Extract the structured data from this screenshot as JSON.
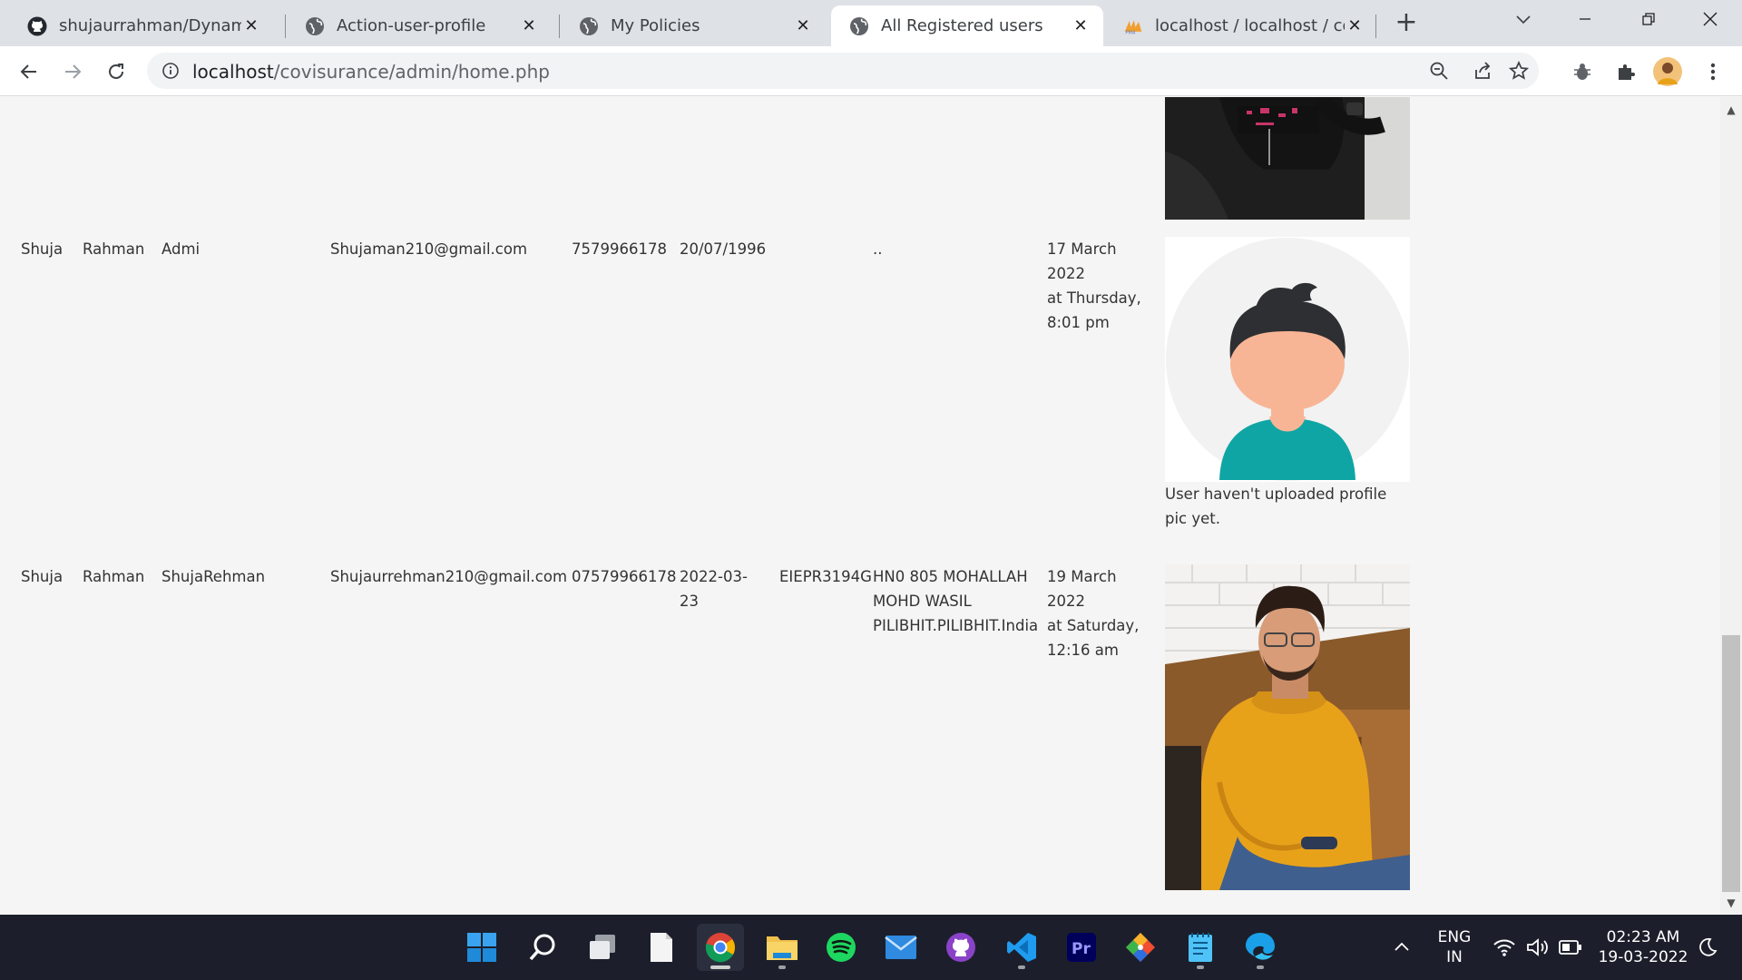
{
  "browser": {
    "tabs": [
      {
        "title": "shujaurrahman/Dynamic-…",
        "icon": "github-icon"
      },
      {
        "title": "Action-user-profile",
        "icon": "globe-icon"
      },
      {
        "title": "My Policies",
        "icon": "globe-icon"
      },
      {
        "title": "All Registered users",
        "icon": "globe-icon",
        "active": true
      },
      {
        "title": "localhost / localhost / cov",
        "icon": "phpmyadmin-icon"
      }
    ],
    "url_host": "localhost",
    "url_path": "/covisurance/admin/home.php"
  },
  "users": [
    {
      "first_name": "Shuja",
      "last_name": "Rahman",
      "username": "Admi",
      "email": "Shujaman210@gmail.com",
      "phone": "7579966178",
      "dob": "20/07/1996",
      "pan": "",
      "address": "..",
      "registered": [
        "17 March 2022",
        "at Thursday,",
        "8:01 pm"
      ],
      "photo": "default-avatar",
      "photo_note": "User haven't uploaded profile pic yet."
    },
    {
      "first_name": "Shuja",
      "last_name": "Rahman",
      "username": "ShujaRehman",
      "email": "Shujaurrehman210@gmail.com",
      "phone": "07579966178",
      "dob_lines": [
        "2022-03-",
        "23"
      ],
      "pan": "EIEPR3194G",
      "address_lines": [
        "HN0 805 MOHALLAH",
        "MOHD WASIL",
        "PILIBHIT.PILIBHIT.India"
      ],
      "registered": [
        "19 March 2022",
        "at Saturday,",
        "12:16 am"
      ],
      "photo": "uploaded-photo"
    }
  ],
  "taskbar": {
    "apps": [
      "windows-start-icon",
      "search-icon",
      "task-view-icon",
      "notepad-file-icon",
      "chrome-icon",
      "file-explorer-icon",
      "spotify-icon",
      "mail-icon",
      "github-desktop-icon",
      "vscode-icon",
      "premiere-pro-icon",
      "git-icon",
      "notepad-icon",
      "edge-icon"
    ],
    "premiere_label": "Pr",
    "lang_line1": "ENG",
    "lang_line2": "IN",
    "time": "02:23 AM",
    "date": "19-03-2022"
  },
  "colors": {
    "tabstrip": "#dee1e6",
    "taskbar": "#1c1f2b",
    "page_bg": "#f5f5f5",
    "avatar_shirt": "#0fa5a5",
    "avatar_skin": "#f8b595",
    "hoodie": "#e8a21a"
  }
}
